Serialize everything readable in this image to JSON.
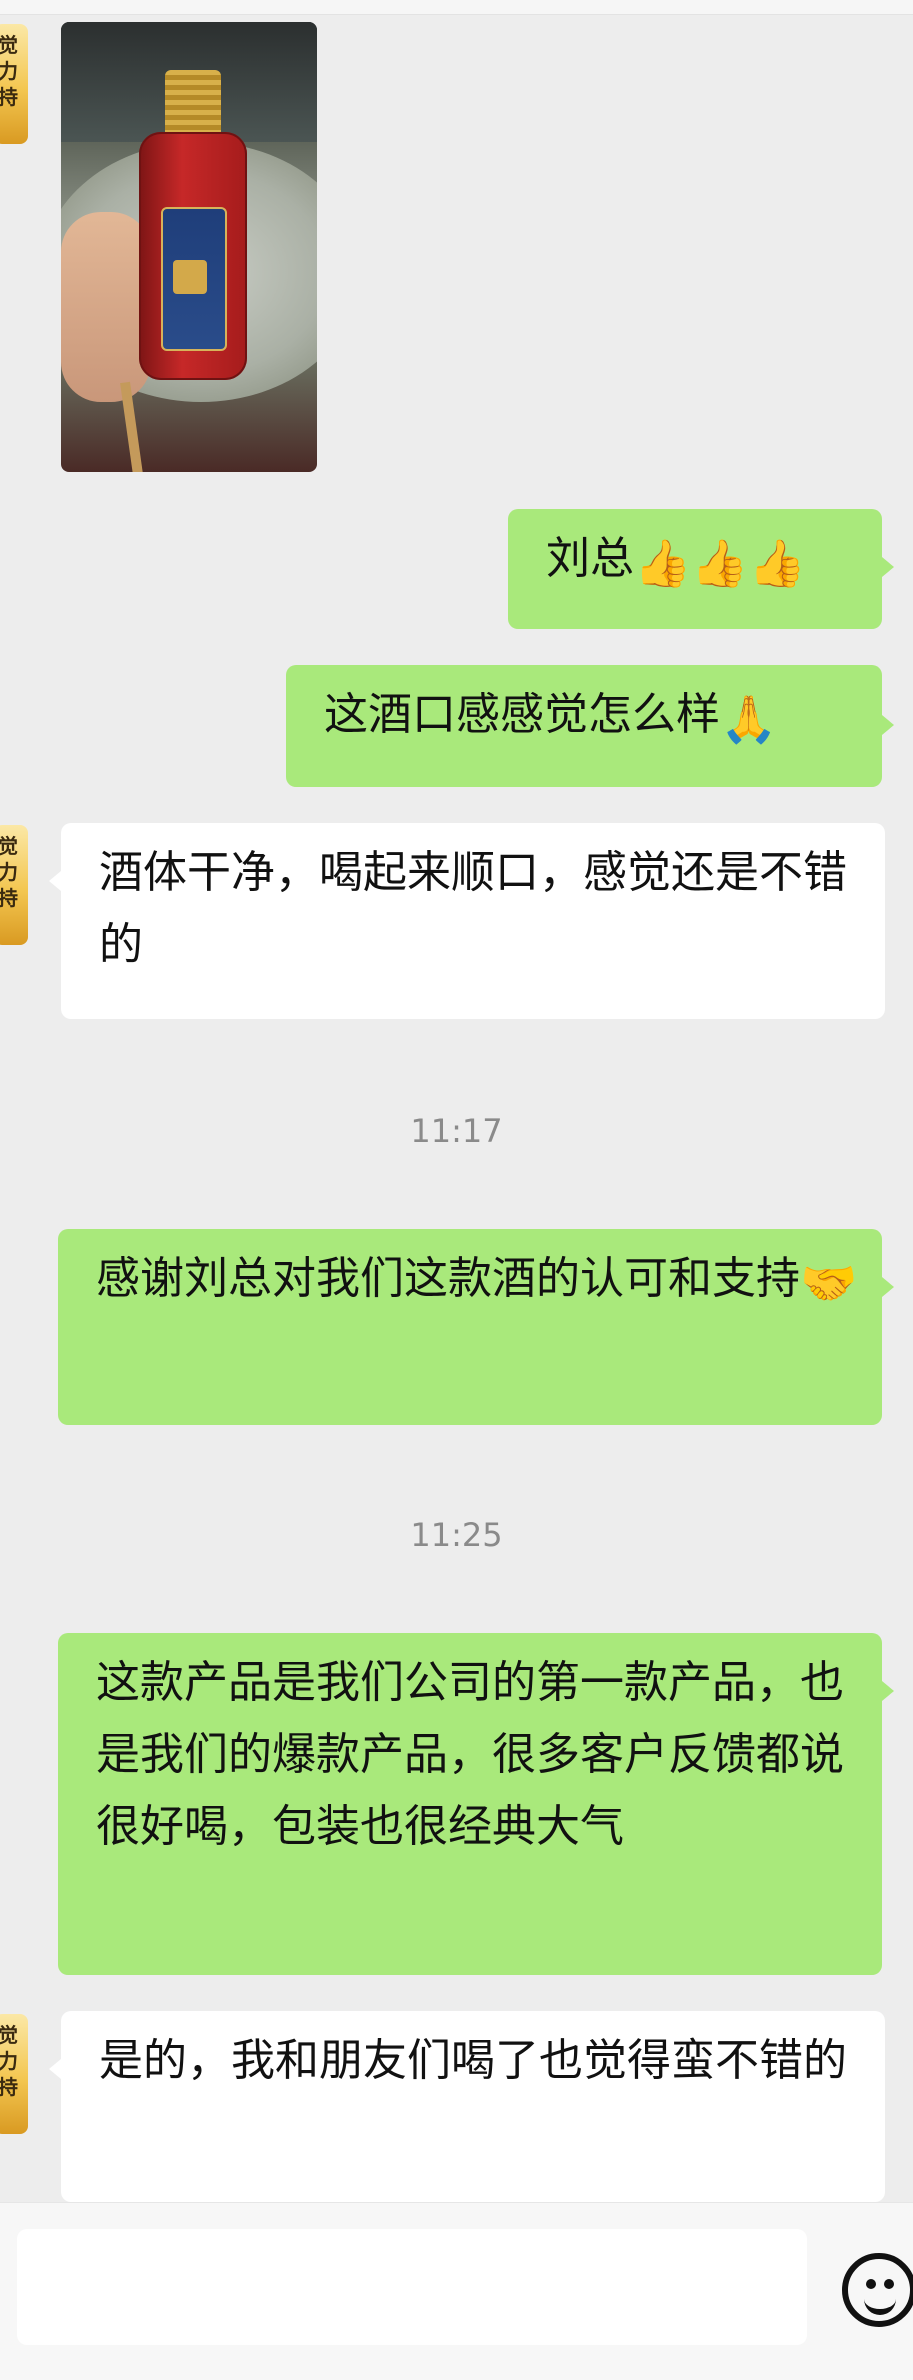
{
  "messages": {
    "m1_text": "刘总",
    "m1_emojis": "👍👍👍",
    "m2_text": "这酒口感感觉怎么样",
    "m2_emoji": "🙏",
    "m3_text": "酒体干净，喝起来顺口，感觉还是不错的",
    "time1": "11:17",
    "m4_text": "感谢刘总对我们这款酒的认可和支持",
    "m4_emoji": "🤝",
    "time2": "11:25",
    "m5_text": "这款产品是我们公司的第一款产品，也是我们的爆款产品，很多客户反馈都说很好喝，包装也很经典大气",
    "m6_text": "是的，我和朋友们喝了也觉得蛮不错的"
  },
  "avatar": {
    "text": "觉力持"
  },
  "composer": {
    "icon": "smiley-icon"
  },
  "colors": {
    "me_bubble": "#a9e97b",
    "other_bubble": "#ffffff",
    "background": "#ededed"
  }
}
